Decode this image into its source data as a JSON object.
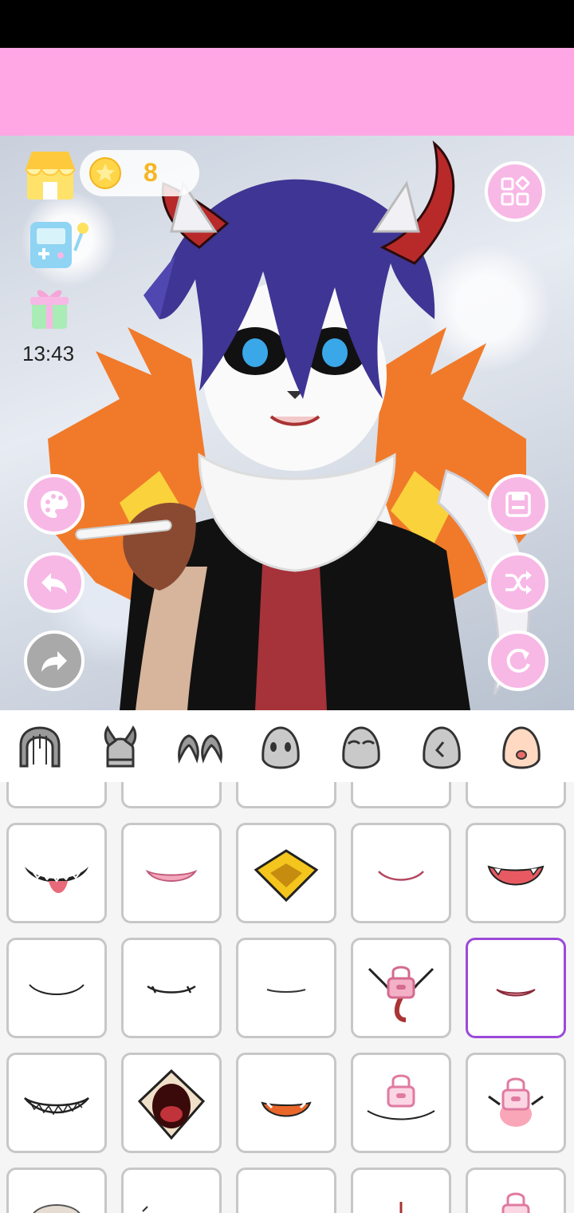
{
  "status_bar": {},
  "ad_banner": {},
  "currency": {
    "coins": "8"
  },
  "clock": {
    "time": "13:43"
  },
  "left_tools": [
    "palette-icon",
    "undo-icon",
    "redo-icon"
  ],
  "right_tools": [
    "save-icon",
    "shuffle-icon",
    "reset-icon"
  ],
  "top_right": {
    "icon": "layout-grid-icon"
  },
  "categories": [
    {
      "name": "hair",
      "icon": "hair-icon"
    },
    {
      "name": "horns",
      "icon": "horns-icon"
    },
    {
      "name": "ears",
      "icon": "ears-icon"
    },
    {
      "name": "eyes",
      "icon": "eyes-icon"
    },
    {
      "name": "eyebrows",
      "icon": "eyebrows-icon"
    },
    {
      "name": "nose",
      "icon": "nose-icon"
    },
    {
      "name": "mouth",
      "icon": "mouth-icon"
    }
  ],
  "mouth_options": {
    "selected_row": 2,
    "selected_col": 5,
    "locked": [
      "row2-col4",
      "row3-col4",
      "row3-col5",
      "row4-col5"
    ]
  },
  "colors": {
    "accent_pink": "#f7b8e6",
    "banner_pink": "#ffa7e4",
    "selection_purple": "#9b4ad8",
    "coin_gold": "#f6b623"
  }
}
